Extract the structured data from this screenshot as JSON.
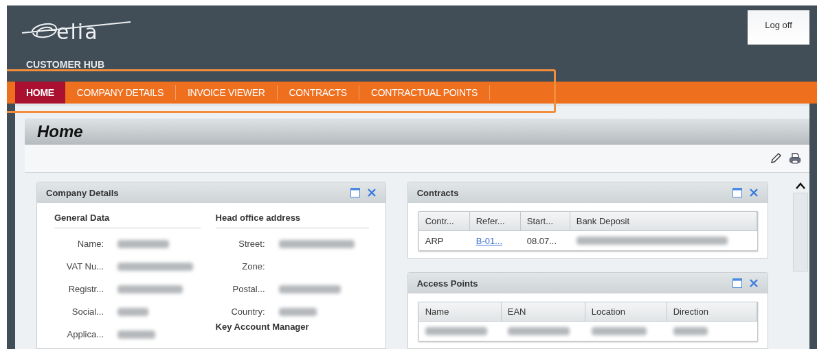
{
  "header": {
    "logo": "elia",
    "subtitle": "CUSTOMER HUB",
    "logoff": "Log off"
  },
  "nav": {
    "highlighted": true,
    "tabs": [
      {
        "label": "HOME",
        "selected": true
      },
      {
        "label": "COMPANY DETAILS",
        "selected": false
      },
      {
        "label": "INVOICE VIEWER",
        "selected": false
      },
      {
        "label": "CONTRACTS",
        "selected": false
      },
      {
        "label": "CONTRACTUAL POINTS",
        "selected": false
      }
    ]
  },
  "page": {
    "title": "Home"
  },
  "company_details": {
    "title": "Company Details",
    "sections": [
      {
        "heading": "General Data",
        "rows": [
          {
            "label": "Name:",
            "blurred": true
          },
          {
            "label": "VAT Nu...",
            "blurred": true
          },
          {
            "label": "Registr...",
            "blurred": true
          },
          {
            "label": "Social...",
            "blurred": true
          },
          {
            "label": "Applica...",
            "blurred": true
          }
        ]
      },
      {
        "heading": "Head office address",
        "rows": [
          {
            "label": "Street:",
            "blurred": true
          },
          {
            "label": "Zone:"
          },
          {
            "label": "Postal...",
            "blurred": true
          },
          {
            "label": "Country:",
            "blurred": true
          }
        ],
        "subheading": "Key Account Manager"
      }
    ]
  },
  "contracts": {
    "title": "Contracts",
    "columns": [
      "Contr...",
      "Refer...",
      "Start...",
      "Bank Deposit"
    ],
    "rows": [
      [
        {
          "text": "ARP"
        },
        {
          "text": "B-01...",
          "link": true
        },
        {
          "text": "08.07..."
        },
        {
          "blurred": true
        }
      ]
    ]
  },
  "access_points": {
    "title": "Access Points",
    "columns": [
      "Name",
      "EAN",
      "Location",
      "Direction"
    ],
    "rows": [
      [
        {
          "blurred": true
        },
        {
          "blurred": true
        },
        {
          "blurred": true
        },
        {
          "blurred": true
        }
      ]
    ]
  }
}
